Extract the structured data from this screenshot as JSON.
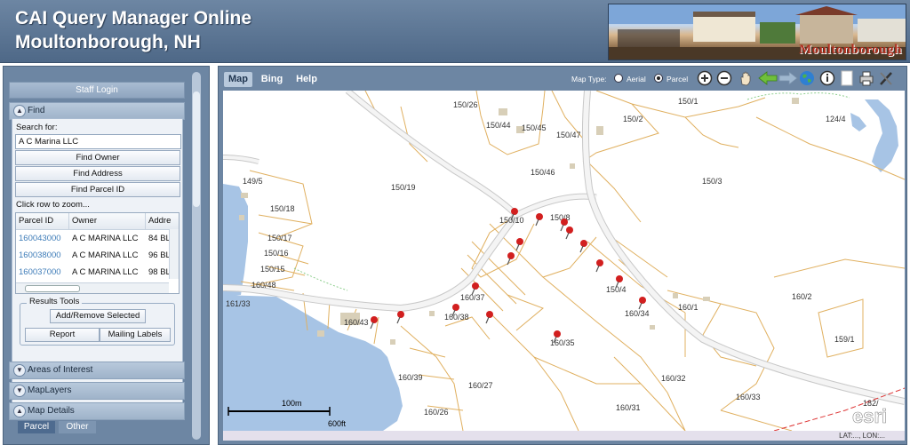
{
  "header": {
    "title": "CAI Query Manager Online",
    "town": "Moultonborough, NH",
    "banner_text": "Moultonborough"
  },
  "left": {
    "staff_login": "Staff Login",
    "find_title": "Find",
    "search_label": "Search for:",
    "search_value": "A C Marina LLC",
    "find_owner": "Find Owner",
    "find_address": "Find Address",
    "find_parcel": "Find Parcel ID",
    "click_row": "Click row to zoom...",
    "columns": [
      "Parcel ID",
      "Owner",
      "Addre"
    ],
    "rows": [
      {
        "parcel": "160043000",
        "owner": "A C MARINA LLC",
        "addr": "84 BL"
      },
      {
        "parcel": "160038000",
        "owner": "A C MARINA LLC",
        "addr": "96 BL"
      },
      {
        "parcel": "160037000",
        "owner": "A C MARINA LLC",
        "addr": "98 BL"
      }
    ],
    "results_tools": "Results Tools",
    "add_remove": "Add/Remove Selected",
    "report": "Report",
    "mailing_labels": "Mailing Labels",
    "areas_of_interest": "Areas of Interest",
    "map_layers": "MapLayers",
    "map_details": "Map Details",
    "tab_parcel": "Parcel",
    "tab_other": "Other"
  },
  "map": {
    "tabs": [
      "Map",
      "Bing",
      "Help"
    ],
    "map_type_label": "Map Type:",
    "aerial": "Aerial",
    "parcel": "Parcel",
    "selected_type": "Parcel",
    "scale_m": "100m",
    "scale_ft": "600ft",
    "logo": "esri",
    "coords": "LAT:..., LON:...",
    "parcels": [
      "150/26",
      "150/1",
      "150/2",
      "124/4",
      "150/44",
      "150/45",
      "150/47",
      "150/46",
      "149/5",
      "150/19",
      "150/3",
      "150/18",
      "150/10",
      "150/8",
      "150/17",
      "150/16",
      "150/15",
      "160/48",
      "161/33",
      "160/37",
      "150/4",
      "160/2",
      "160/43",
      "160/38",
      "160/34",
      "160/1",
      "159/1",
      "160/35",
      "160/39",
      "160/27",
      "160/32",
      "160/33",
      "182/",
      "160/26",
      "160/31"
    ]
  },
  "colors": {
    "frame": "#6d86a3",
    "water": "#a7c4e5",
    "parcel_lines": "#e0b060",
    "roads": "#c8c8c8",
    "pin": "#d21f1f"
  }
}
